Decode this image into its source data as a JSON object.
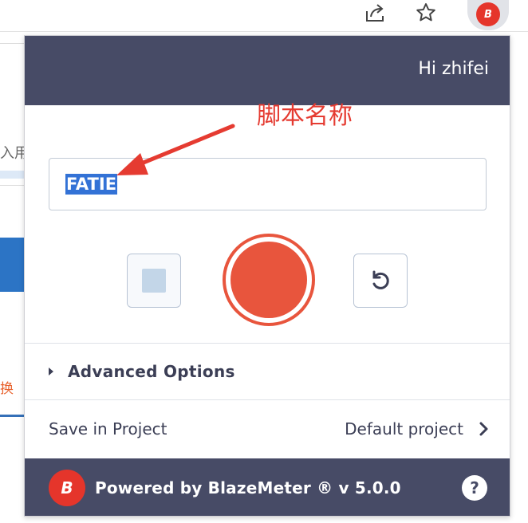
{
  "browser": {
    "share_icon": "share-icon",
    "star_icon": "star-icon",
    "extension_icon": "blazemeter-icon",
    "extension_glyph": "B"
  },
  "background_page": {
    "text_fragment_1": "入用",
    "text_fragment_2": "换",
    "accent_color": "#2c74c5"
  },
  "popup": {
    "greeting": "Hi zhifei",
    "script_name_value": "FATIE",
    "controls": {
      "stop_icon": "stop-icon",
      "record_icon": "record-icon",
      "reset_icon": "reset-icon"
    },
    "advanced_options_label": "Advanced Options",
    "save_in_project_label": "Save in Project",
    "project_value": "Default project",
    "footer": {
      "logo_glyph": "B",
      "powered_text": "Powered by BlazeMeter ® v 5.0.0",
      "help_glyph": "?"
    },
    "colors": {
      "header_bg": "#474b66",
      "record": "#e8553d",
      "brand": "#e5352b",
      "selection": "#3372d6"
    }
  },
  "annotation": {
    "label": "脚本名称",
    "color": "#e53b31"
  }
}
